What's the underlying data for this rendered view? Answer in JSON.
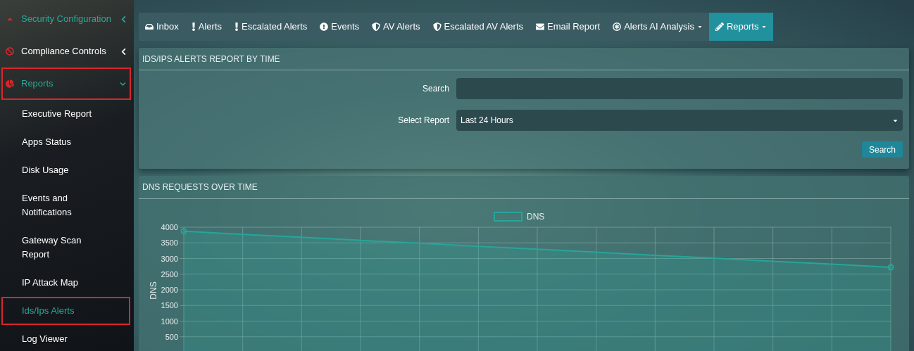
{
  "sidebar": {
    "items": [
      {
        "label": "Security Configuration",
        "selected": true,
        "outlined": false
      },
      {
        "label": "Compliance Controls",
        "selected": false,
        "outlined": false
      },
      {
        "label": "Reports",
        "selected": true,
        "outlined": true,
        "children": [
          {
            "label": "Executive Report",
            "selected": false,
            "outlined": false
          },
          {
            "label": "Apps Status",
            "selected": false,
            "outlined": false
          },
          {
            "label": "Disk Usage",
            "selected": false,
            "outlined": false
          },
          {
            "label": "Events and Notifications",
            "selected": false,
            "outlined": false
          },
          {
            "label": "Gateway Scan Report",
            "selected": false,
            "outlined": false
          },
          {
            "label": "IP Attack Map",
            "selected": false,
            "outlined": false
          },
          {
            "label": "Ids/Ips Alerts",
            "selected": true,
            "outlined": true
          },
          {
            "label": "Log Viewer",
            "selected": false,
            "outlined": false
          }
        ]
      }
    ]
  },
  "tabs": [
    {
      "label": "Inbox",
      "dropdown": false,
      "selected": false
    },
    {
      "label": "Alerts",
      "dropdown": false,
      "selected": false
    },
    {
      "label": "Escalated Alerts",
      "dropdown": false,
      "selected": false
    },
    {
      "label": "Events",
      "dropdown": false,
      "selected": false
    },
    {
      "label": "AV Alerts",
      "dropdown": false,
      "selected": false
    },
    {
      "label": "Escalated AV Alerts",
      "dropdown": false,
      "selected": false
    },
    {
      "label": "Email Report",
      "dropdown": false,
      "selected": false
    },
    {
      "label": "Alerts AI Analysis",
      "dropdown": true,
      "selected": false
    },
    {
      "label": "Reports",
      "dropdown": true,
      "selected": true
    }
  ],
  "report_panel": {
    "title": "IDS/IPS ALERTS REPORT BY TIME",
    "search_label": "Search",
    "select_label": "Select Report",
    "select_value": "Last 24 Hours",
    "button": "Search"
  },
  "chart_panel": {
    "title": "DNS REQUESTS OVER TIME",
    "chart_data": {
      "type": "area",
      "ylabel": "DNS",
      "grid": true,
      "categories": [
        null,
        null,
        null,
        null,
        null,
        null,
        null,
        null,
        null,
        null,
        null,
        null,
        null
      ],
      "series": [
        {
          "name": "DNS",
          "color": "#26a69a",
          "values": [
            3870,
            3770,
            3680,
            3580,
            3490,
            3390,
            3300,
            3200,
            3100,
            3010,
            2910,
            2820,
            2720
          ]
        }
      ],
      "ylim": [
        0,
        4000
      ],
      "yticks": [
        500,
        1000,
        1500,
        2000,
        2500,
        3000,
        3500,
        4000
      ]
    }
  }
}
